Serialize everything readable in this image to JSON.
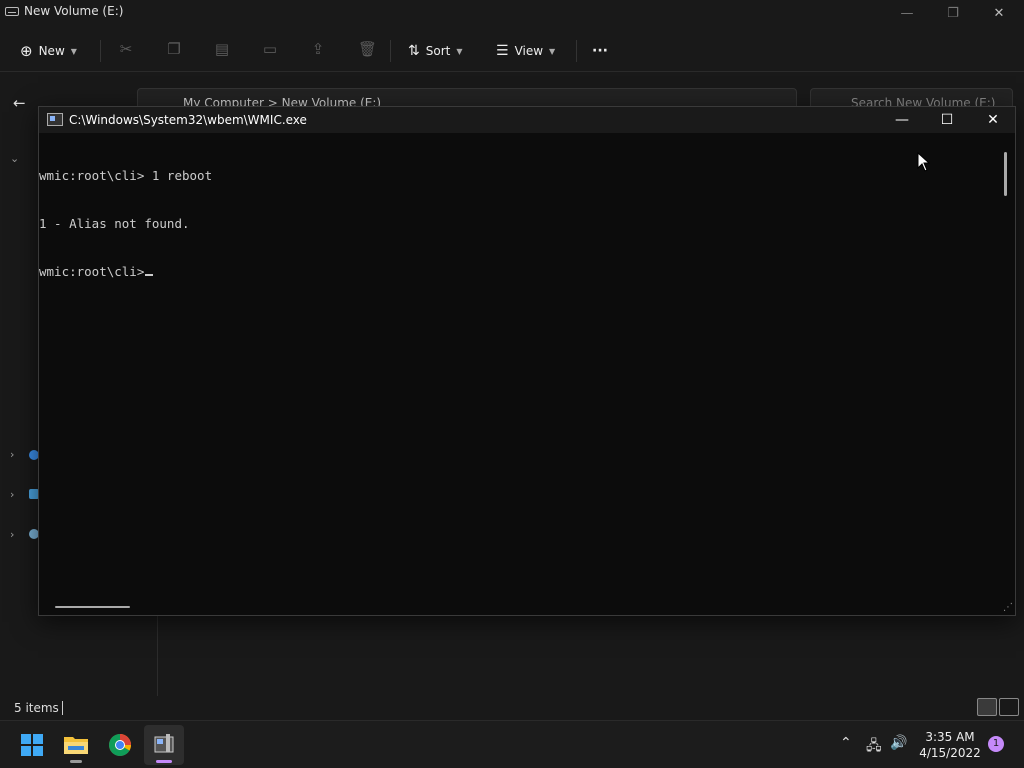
{
  "explorer": {
    "title": "New Volume (E:)",
    "toolbar": {
      "new_label": "New",
      "sort_label": "Sort",
      "view_label": "View",
      "more_label": "···"
    },
    "breadcrumb": [
      "My Computer",
      ">",
      "New Volume (E:)"
    ],
    "search_placeholder": "Search New Volume (E:)",
    "status": {
      "item_count": "5 items"
    }
  },
  "console": {
    "title": "C:\\Windows\\System32\\wbem\\WMIC.exe",
    "lines": [
      "wmic:root\\cli> 1 reboot",
      "1 - Alias not found.",
      "wmic:root\\cli>"
    ],
    "colors": {
      "background": "#0c0c0c",
      "text": "#cccccc"
    }
  },
  "taskbar": {
    "apps": [
      "start-button",
      "file-explorer",
      "chrome",
      "wmic"
    ],
    "clock": {
      "time": "3:35 AM",
      "date": "4/15/2022"
    },
    "notification_count": "1"
  }
}
